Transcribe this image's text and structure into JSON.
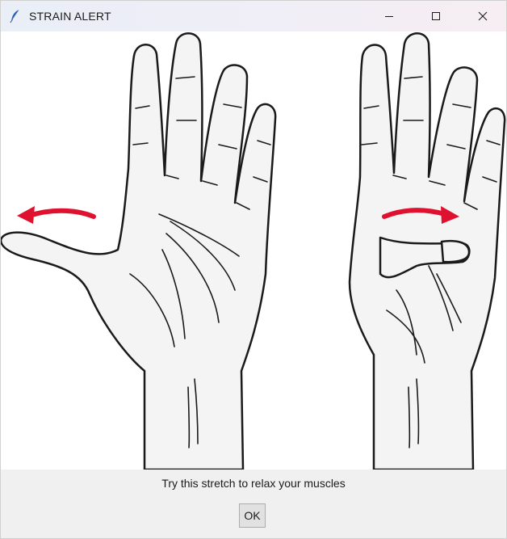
{
  "window": {
    "title": "STRAIN ALERT",
    "icon": "feather-icon",
    "controls": [
      "minimize-icon",
      "maximize-icon",
      "close-icon"
    ]
  },
  "illustration": {
    "left_hand": "open-hand-thumb-out",
    "right_hand": "hand-thumb-folded-in",
    "arrow_color": "#e0102f",
    "skin_color": "#f4f4f4",
    "outline_color": "#1a1a1a"
  },
  "dialog": {
    "message": "Try this stretch to relax your muscles",
    "ok_label": "OK"
  }
}
